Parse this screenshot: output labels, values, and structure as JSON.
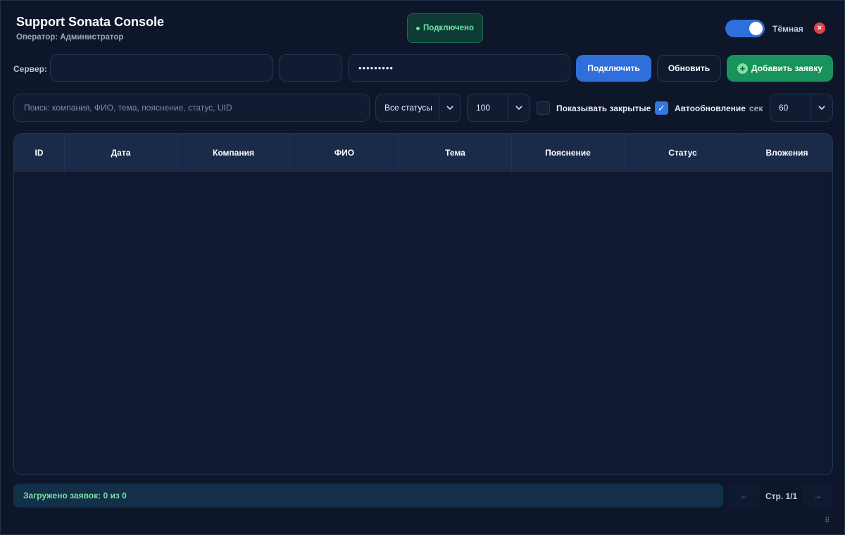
{
  "header": {
    "title": "Support Sonata Console",
    "operator": "Оператор: Администратор",
    "connection_status": "Подключено",
    "theme_label": "Тёмная",
    "theme_dark_enabled": true,
    "close_glyph": "×"
  },
  "connection": {
    "server_label": "Сервер:",
    "server_value": "",
    "port_value": "",
    "password_value": "•••••••••",
    "connect_label": "Подключить",
    "refresh_label": "Обновить",
    "add_label": "Добавить заявку",
    "add_icon_glyph": "+"
  },
  "filters": {
    "search_placeholder": "Поиск: компания, ФИО, тема, пояснение, статус, UID",
    "status_selected": "Все статусы",
    "limit_selected": "100",
    "show_closed_label": "Показывать закрытые",
    "show_closed_checked": false,
    "auto_refresh_label": "Автообновление",
    "auto_refresh_checked": true,
    "checkmark_glyph": "✓",
    "seconds_label": "сек",
    "interval_selected": "60",
    "dropdown_glyph": "⌄"
  },
  "table": {
    "columns": [
      "ID",
      "Дата",
      "Компания",
      "ФИО",
      "Тема",
      "Пояснение",
      "Статус",
      "Вложения"
    ],
    "rows": []
  },
  "footer": {
    "loaded_text": "Загружено заявок: 0 из 0",
    "page_text": "Стр. 1/1",
    "prev_glyph": "←",
    "next_glyph": "→",
    "grip_glyph": "⠿"
  },
  "colors": {
    "accent": "#2f6fdc",
    "success": "#17935b",
    "connected": "#6ee7a8",
    "danger": "#e0444f",
    "background": "#0e1729"
  }
}
